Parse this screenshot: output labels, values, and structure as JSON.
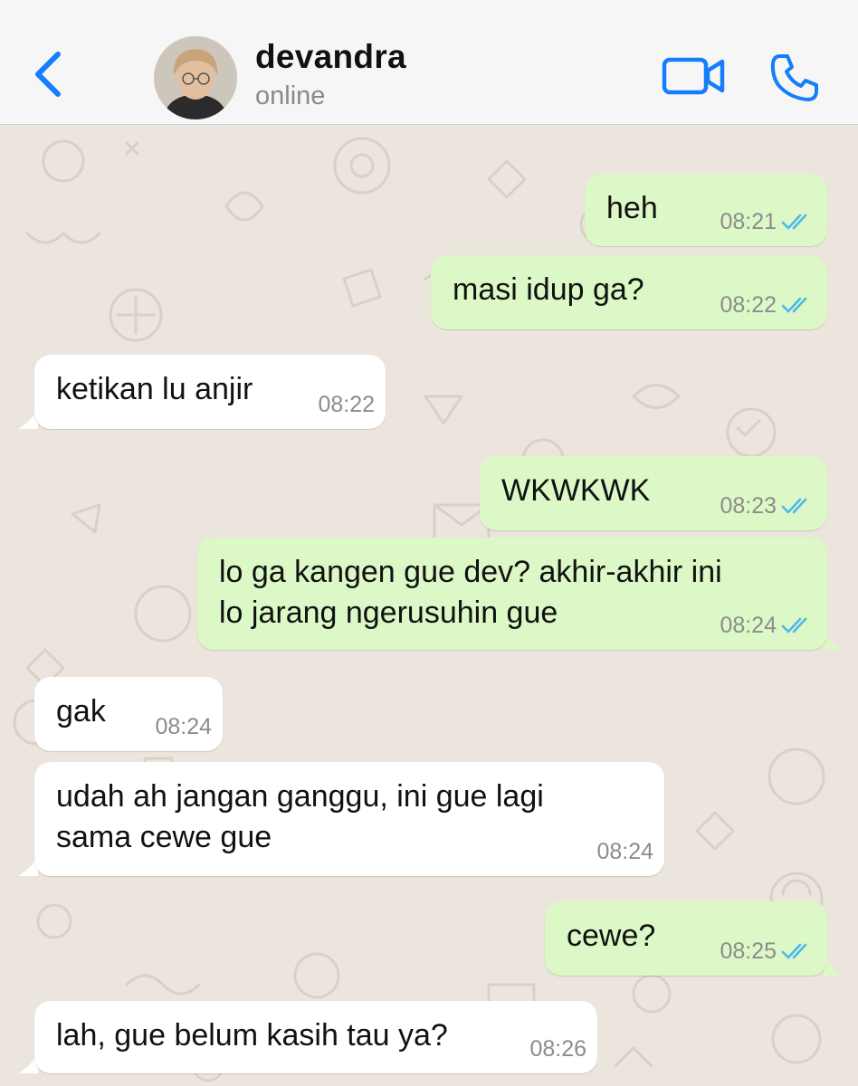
{
  "header": {
    "contact_name": "devandra",
    "status": "online",
    "icons": {
      "back": "chevron-left-icon",
      "video": "video-camera-icon",
      "call": "phone-icon"
    }
  },
  "colors": {
    "accent": "#147efb",
    "outgoing_bubble": "#dcf8c6",
    "incoming_bubble": "#ffffff",
    "read_ticks": "#4fb6ec",
    "chat_background": "#ece5dd"
  },
  "messages": [
    {
      "direction": "out",
      "text": "heh",
      "time": "08:21",
      "read": true
    },
    {
      "direction": "out",
      "text": "masi idup ga?",
      "time": "08:22",
      "read": true
    },
    {
      "direction": "in",
      "text": "ketikan lu anjir",
      "time": "08:22"
    },
    {
      "direction": "out",
      "text": "WKWKWK",
      "time": "08:23",
      "read": true
    },
    {
      "direction": "out",
      "text": "lo ga kangen gue dev? akhir-akhir ini",
      "text_line2": "lo jarang ngerusuhin gue",
      "time": "08:24",
      "read": true
    },
    {
      "direction": "in",
      "text": "gak",
      "time": "08:24"
    },
    {
      "direction": "in",
      "text": "udah ah jangan ganggu, ini gue lagi",
      "text_line2": "sama cewe gue",
      "time": "08:24"
    },
    {
      "direction": "out",
      "text": "cewe?",
      "time": "08:25",
      "read": true
    },
    {
      "direction": "in",
      "text": "lah, gue belum kasih tau ya?",
      "time": "08:26"
    }
  ]
}
